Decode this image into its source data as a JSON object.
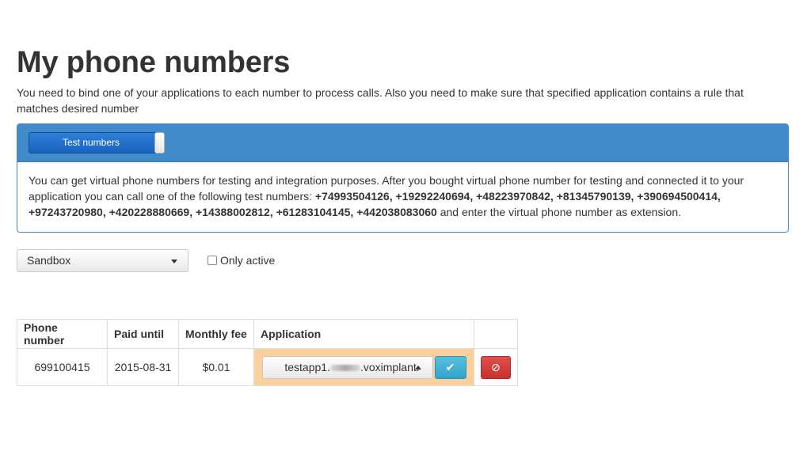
{
  "page": {
    "title": "My phone numbers",
    "intro": "You need to bind one of your applications to each number to process calls. Also you need to make sure that specified application contains a rule that matches desired number"
  },
  "panel": {
    "toggle_label": "Test numbers",
    "body_prefix": "You can get virtual phone numbers for testing and integration purposes. After you bought virtual phone number for testing and connected it to your application you can call one of the following test numbers: ",
    "test_numbers": "+74993504126, +19292240694, +48223970842, +81345790139, +390694500414, +97243720980, +420228880669, +14388002812, +61283104145, +442038083060",
    "body_suffix": " and enter the virtual phone number as extension."
  },
  "filters": {
    "environment_selected": "Sandbox",
    "only_active_label": "Only active",
    "only_active_checked": false
  },
  "table": {
    "headers": {
      "phone_number": "Phone number",
      "paid_until": "Paid until",
      "monthly_fee": "Monthly fee",
      "application": "Application"
    },
    "rows": [
      {
        "phone_number": "699100415",
        "paid_until": "2015-08-31",
        "monthly_fee": "$0.01",
        "application_prefix": "testapp1.",
        "application_suffix": ".voximplant.",
        "confirm_icon": "✔",
        "delete_icon": "⊘"
      }
    ]
  },
  "colors": {
    "panel_blue": "#428bca",
    "app_cell_highlight": "#fbd09c",
    "confirm_button": "#5bc0de",
    "delete_button": "#d9534f"
  }
}
